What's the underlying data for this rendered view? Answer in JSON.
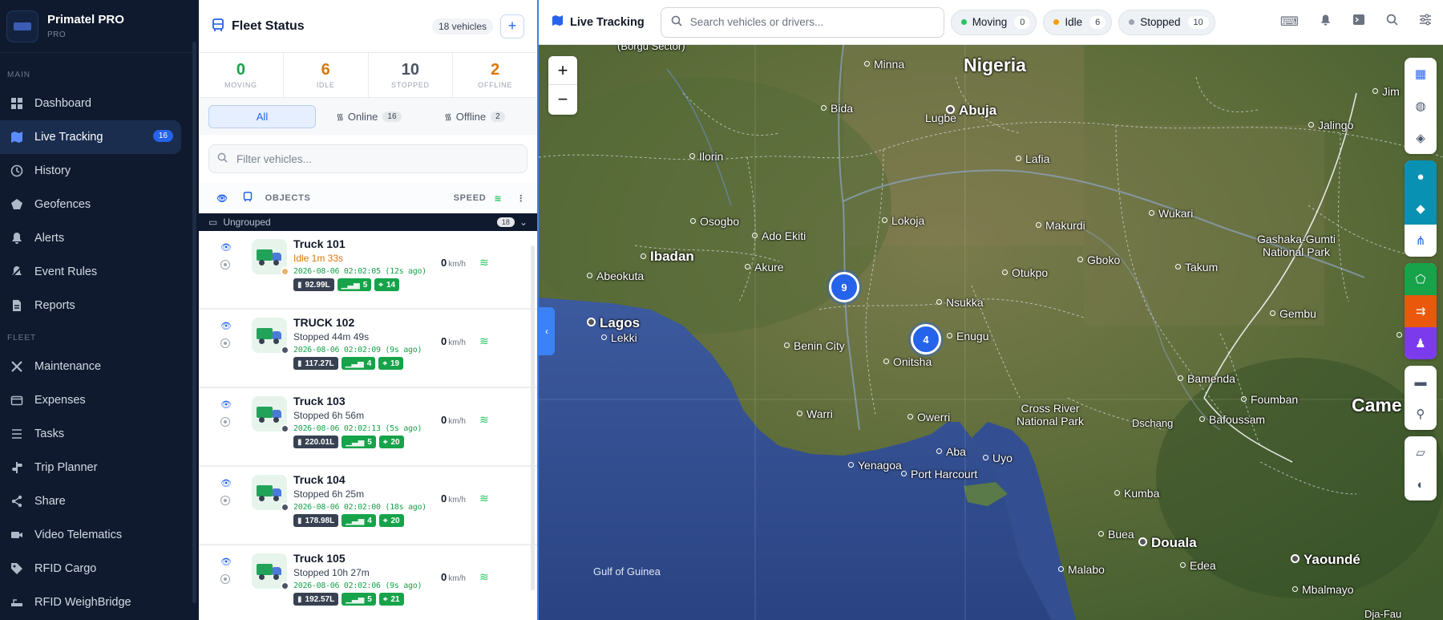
{
  "brand": {
    "name": "Primatel PRO",
    "sub": "PRO"
  },
  "sidebar": {
    "section_main": "MAIN",
    "section_fleet": "FLEET",
    "items": [
      {
        "label": "Dashboard",
        "icon": "dashboard-icon"
      },
      {
        "label": "Live Tracking",
        "icon": "map-icon",
        "badge": "16",
        "active": true
      },
      {
        "label": "History",
        "icon": "clock-icon"
      },
      {
        "label": "Geofences",
        "icon": "pentagon-icon"
      },
      {
        "label": "Alerts",
        "icon": "bell-icon"
      },
      {
        "label": "Event Rules",
        "icon": "bell-off-icon"
      },
      {
        "label": "Reports",
        "icon": "report-icon"
      },
      {
        "label": "Maintenance",
        "icon": "wrench-icon"
      },
      {
        "label": "Expenses",
        "icon": "wallet-icon"
      },
      {
        "label": "Tasks",
        "icon": "list-icon"
      },
      {
        "label": "Trip Planner",
        "icon": "signpost-icon"
      },
      {
        "label": "Share",
        "icon": "share-icon"
      },
      {
        "label": "Video Telematics",
        "icon": "video-icon"
      },
      {
        "label": "RFID Cargo",
        "icon": "tag-icon"
      },
      {
        "label": "RFID WeighBridge",
        "icon": "scale-icon"
      }
    ]
  },
  "fleet": {
    "title": "Fleet Status",
    "vehicle_count": "18 vehicles",
    "add_label": "+",
    "stats": [
      {
        "value": "0",
        "label": "MOVING",
        "color": "#16a34a"
      },
      {
        "value": "6",
        "label": "IDLE",
        "color": "#d97706"
      },
      {
        "value": "10",
        "label": "STOPPED",
        "color": "#4b5563"
      },
      {
        "value": "2",
        "label": "OFFLINE",
        "color": "#d97706"
      }
    ],
    "tabs": [
      {
        "label": "All",
        "count": ""
      },
      {
        "label": "Online",
        "count": "16"
      },
      {
        "label": "Offline",
        "count": "2"
      }
    ],
    "filter_placeholder": "Filter vehicles...",
    "columns": {
      "objects": "OBJECTS",
      "speed": "SPEED"
    },
    "group": {
      "label": "Ungrouped",
      "count": "18"
    },
    "vehicles": [
      {
        "name": "Truck 101",
        "status": "Idle 1m 33s",
        "status_color": "#d97706",
        "dot": "#e8b46b",
        "time": "2026-08-06 02:02:05 (12s ago)",
        "fuel": "92.99L",
        "signal": "5",
        "sats": "14",
        "speed": "0",
        "unit": "km/h"
      },
      {
        "name": "TRUCK 102",
        "status": "Stopped 44m 49s",
        "status_color": "#374151",
        "dot": "#4b5563",
        "time": "2026-08-06 02:02:09 (9s ago)",
        "fuel": "117.27L",
        "signal": "4",
        "sats": "19",
        "speed": "0",
        "unit": "km/h"
      },
      {
        "name": "Truck 103",
        "status": "Stopped 6h 56m",
        "status_color": "#374151",
        "dot": "#4b5563",
        "time": "2026-08-06 02:02:13 (5s ago)",
        "fuel": "220.01L",
        "signal": "5",
        "sats": "20",
        "speed": "0",
        "unit": "km/h"
      },
      {
        "name": "Truck 104",
        "status": "Stopped 6h 25m",
        "status_color": "#374151",
        "dot": "#4b5563",
        "time": "2026-08-06 02:02:00 (18s ago)",
        "fuel": "178.98L",
        "signal": "4",
        "sats": "20",
        "speed": "0",
        "unit": "km/h"
      },
      {
        "name": "Truck 105",
        "status": "Stopped 10h 27m",
        "status_color": "#374151",
        "dot": "#4b5563",
        "time": "2026-08-06 02:02:06 (9s ago)",
        "fuel": "192.57L",
        "signal": "5",
        "sats": "21",
        "speed": "0",
        "unit": "km/h"
      }
    ]
  },
  "topbar": {
    "title": "Live Tracking",
    "search_placeholder": "Search vehicles or drivers...",
    "pills": [
      {
        "label": "Moving",
        "count": "0",
        "color": "#22c55e"
      },
      {
        "label": "Idle",
        "count": "6",
        "color": "#f59e0b"
      },
      {
        "label": "Stopped",
        "count": "10",
        "color": "#9ca3af"
      }
    ],
    "icons": [
      "translate-icon",
      "bell-icon",
      "terminal-icon",
      "search-icon",
      "sliders-icon"
    ]
  },
  "map": {
    "zoom_in": "+",
    "zoom_out": "−",
    "clusters": [
      {
        "count": "9"
      },
      {
        "count": "4"
      }
    ],
    "labels": {
      "borgu": "(Borgu Sector)",
      "minna": "Minna",
      "nigeria": "Nigeria",
      "bida": "Bida",
      "lugbe": "Lugbe",
      "abuja": "Abuja",
      "jimeta": "Jim",
      "jalingo": "Jalingo",
      "ilorin": "Ilorin",
      "lafia": "Lafia",
      "osogbo": "Osogbo",
      "lokoja": "Lokoja",
      "makurdi": "Makurdi",
      "wukari": "Wukari",
      "gashaka": "Gashaka-Gumti National Park",
      "ibadan": "Ibadan",
      "ado_ekiti": "Ado Ekiti",
      "akure": "Akure",
      "gboko": "Gboko",
      "otukpo": "Otukpo",
      "takum": "Takum",
      "abeokuta": "Abeokuta",
      "nsukka": "Nsukka",
      "gembu": "Gembu",
      "lagos": "Lagos",
      "lekki": "Lekki",
      "enugu": "Enugu",
      "benin_city": "Benin City",
      "onitsha": "Onitsha",
      "bamenda": "Bamenda",
      "foumban": "Foumban",
      "cross_river": "Cross River National Park",
      "cameroon": "Came",
      "warri": "Warri",
      "owerri": "Owerri",
      "dschang": "Dschang",
      "bafoussam": "Bafoussam",
      "aba": "Aba",
      "uyo": "Uyo",
      "yenagoa": "Yenagoa",
      "port_harcourt": "Port Harcourt",
      "kumba": "Kumba",
      "buea": "Buea",
      "douala": "Douala",
      "gulf": "Gulf of Guinea",
      "malabo": "Malabo",
      "edea": "Edea",
      "yaounde": "Yaoundé",
      "mbalmayo": "Mbalmayo",
      "dja": "Dja-Fau",
      "t": "T"
    }
  }
}
